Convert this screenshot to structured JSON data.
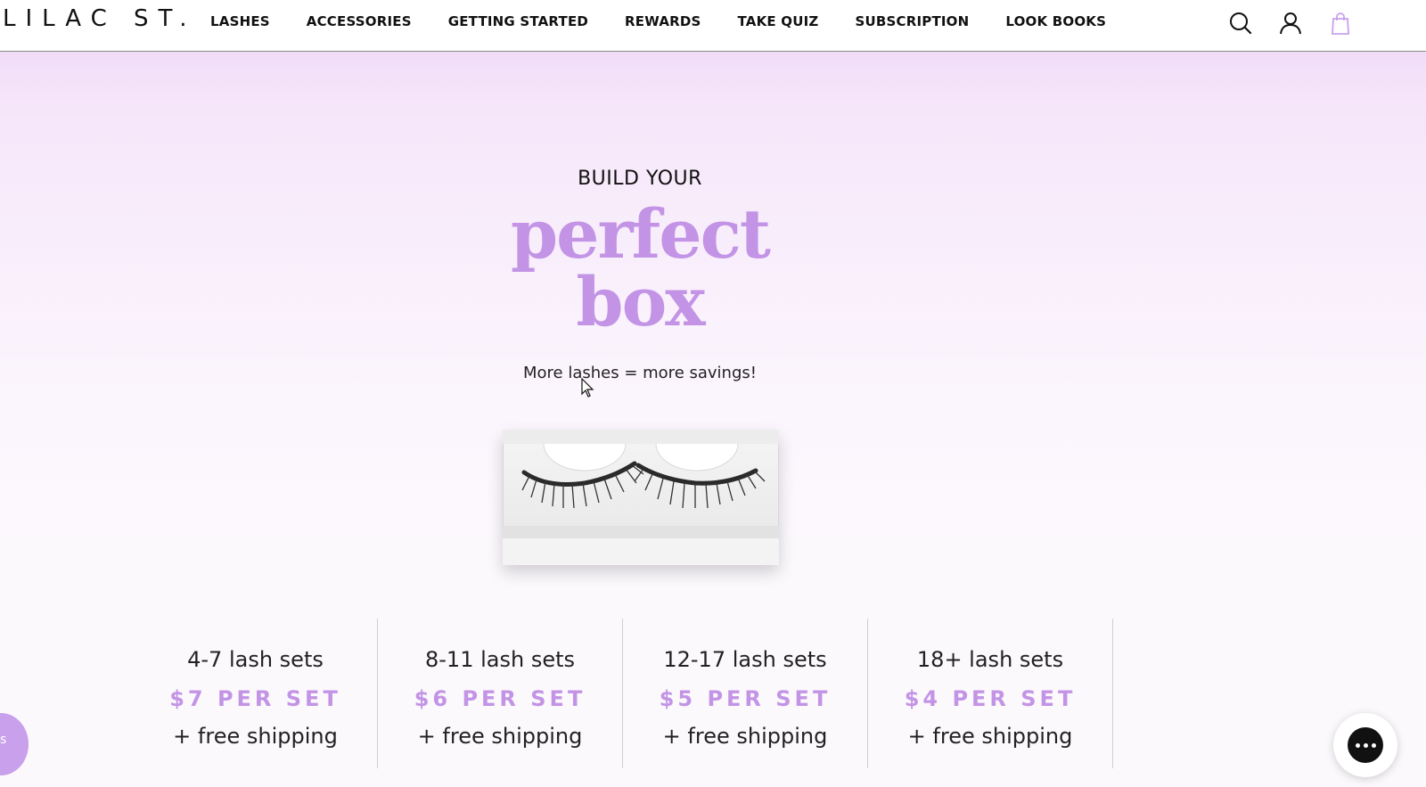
{
  "header": {
    "logo": "LILAC ST.",
    "nav": [
      {
        "label": "LASHES"
      },
      {
        "label": "ACCESSORIES"
      },
      {
        "label": "GETTING STARTED"
      },
      {
        "label": "REWARDS"
      },
      {
        "label": "TAKE QUIZ"
      },
      {
        "label": "SUBSCRIPTION"
      },
      {
        "label": "LOOK BOOKS"
      }
    ],
    "icons": [
      "search-icon",
      "account-icon",
      "shopping-bag-icon"
    ]
  },
  "hero": {
    "kicker": "BUILD YOUR",
    "headline_line1": "perfect",
    "headline_line2": "box",
    "tagline": "More lashes = more savings!"
  },
  "tiers": [
    {
      "range": "4-7 lash sets",
      "price": "$7 PER SET",
      "shipping": "+ free shipping"
    },
    {
      "range": "8-11 lash sets",
      "price": "$6 PER SET",
      "shipping": "+ free shipping"
    },
    {
      "range": "12-17 lash sets",
      "price": "$5 PER SET",
      "shipping": "+ free shipping"
    },
    {
      "range": "18+ lash sets",
      "price": "$4 PER SET",
      "shipping": "+ free shipping"
    }
  ],
  "rewards_bubble": {
    "label": "s"
  },
  "colors": {
    "accent": "#c394e6",
    "text": "#1a1a1a",
    "bag_icon": "#c9a0ec"
  }
}
